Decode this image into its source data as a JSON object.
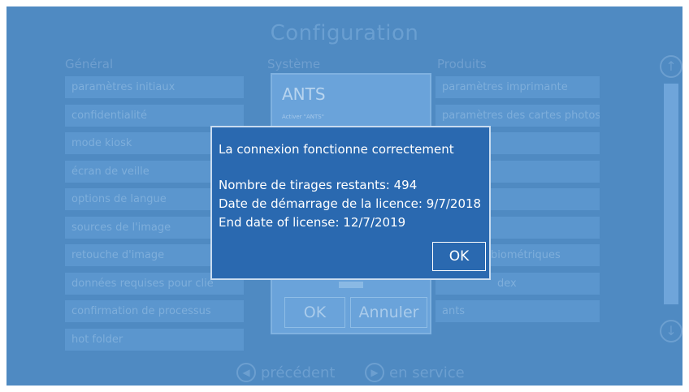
{
  "title": "Configuration",
  "columns": {
    "general": {
      "heading": "Général",
      "items": [
        "paramètres initiaux",
        "confidentialité",
        "mode kiosk",
        "écran de veille",
        "options de langue",
        "sources de l'image",
        "retouche d'image",
        "données requises pour clie",
        "confirmation de processus",
        "hot folder"
      ]
    },
    "system": {
      "heading": "Système"
    },
    "products": {
      "heading": "Produits",
      "items": [
        "paramètres imprimante",
        "paramètres des cartes photos",
        "",
        "",
        "",
        "",
        "biométriques",
        "dex",
        "ants"
      ]
    }
  },
  "ants_panel": {
    "title": "ANTS",
    "subtitle": "Activer \"ANTS\"",
    "ok": "OK",
    "cancel": "Annuler"
  },
  "dialog": {
    "message": "La connexion fonctionne correctement",
    "lines": [
      "Nombre de tirages restants: 494",
      "Date de démarrage de la licence: 9/7/2018",
      "End date of license: 12/7/2019"
    ],
    "ok": "OK"
  },
  "nav": {
    "previous": "précédent",
    "in_service": "en service"
  },
  "colors": {
    "background": "#4f8ac2",
    "dialog": "#2a69b0",
    "button": "#5b96ce"
  }
}
